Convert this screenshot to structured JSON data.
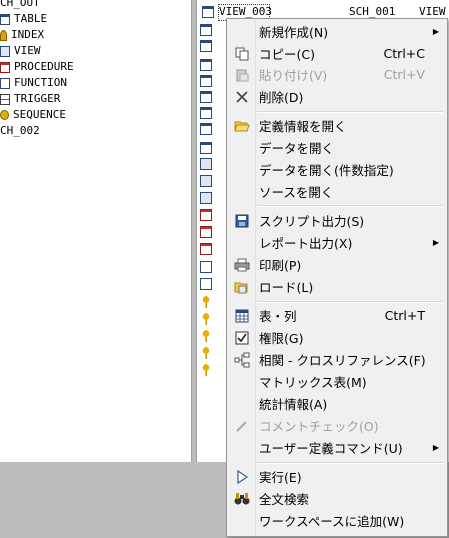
{
  "left_tree": {
    "items": [
      {
        "label": "CH_OUT",
        "icon": "none"
      },
      {
        "label": "TABLE",
        "icon": "table-icon"
      },
      {
        "label": "INDEX",
        "icon": "index-icon"
      },
      {
        "label": "VIEW",
        "icon": "view-icon"
      },
      {
        "label": "PROCEDURE",
        "icon": "procedure-icon"
      },
      {
        "label": "FUNCTION",
        "icon": "function-icon"
      },
      {
        "label": "TRIGGER",
        "icon": "trigger-icon"
      },
      {
        "label": "SEQUENCE",
        "icon": "sequence-icon"
      },
      {
        "label": "CH_002",
        "icon": "none"
      }
    ]
  },
  "right_list": {
    "selected_name": "VIEW_003",
    "selected_schema": "SCH_001",
    "selected_type": "VIEW"
  },
  "context_menu": {
    "new": "新規作成(N)",
    "copy": "コピー(C)",
    "copy_shortcut": "Ctrl+C",
    "paste": "貼り付け(V)",
    "paste_shortcut": "Ctrl+V",
    "delete": "削除(D)",
    "open_definition": "定義情報を開く",
    "open_data": "データを開く",
    "open_data_cond": "データを開く(件数指定)",
    "open_source": "ソースを開く",
    "script_output": "スクリプト出力(S)",
    "report_output": "レポート出力(X)",
    "print": "印刷(P)",
    "load": "ロード(L)",
    "table_column": "表・列",
    "table_column_shortcut": "Ctrl+T",
    "privilege": "権限(G)",
    "cross_reference": "相関 - クロスリファレンス(F)",
    "matrix": "マトリックス表(M)",
    "statistics": "統計情報(A)",
    "comment_check": "コメントチェック(O)",
    "user_command": "ユーザー定義コマンド(U)",
    "execute": "実行(E)",
    "fulltext_search": "全文検索",
    "add_workspace": "ワークスペースに追加(W)"
  }
}
